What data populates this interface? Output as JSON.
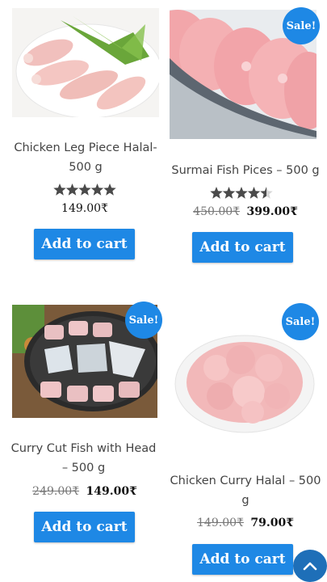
{
  "products": [
    {
      "title_line1": "Chicken Leg Piece Halal-",
      "title_line2": "500 g",
      "rating": 5,
      "old_price": "",
      "price": "149.00₹",
      "sale_badge": "",
      "button": "Add to cart"
    },
    {
      "title_line1": "Surmai Fish Pices – 500 g",
      "title_line2": "",
      "rating": 4.5,
      "old_price": "450.00₹",
      "price": "399.00₹",
      "sale_badge": "Sale!",
      "button": "Add to cart"
    },
    {
      "title_line1": "Curry Cut Fish with Head",
      "title_line2": "– 500 g",
      "rating": 0,
      "old_price": "249.00₹",
      "price": "149.00₹",
      "sale_badge": "Sale!",
      "button": "Add to cart"
    },
    {
      "title_line1": "Chicken Curry Halal – 500",
      "title_line2": "g",
      "rating": 0,
      "old_price": "149.00₹",
      "price": "79.00₹",
      "sale_badge": "Sale!",
      "button": "Add to cart"
    }
  ],
  "icons": {
    "scroll_top": "chevron-up-icon",
    "star": "star-icon"
  },
  "colors": {
    "accent": "#1e88e5",
    "scroll_top_bg": "#1e6fb8",
    "star": "#4a4a4a"
  }
}
